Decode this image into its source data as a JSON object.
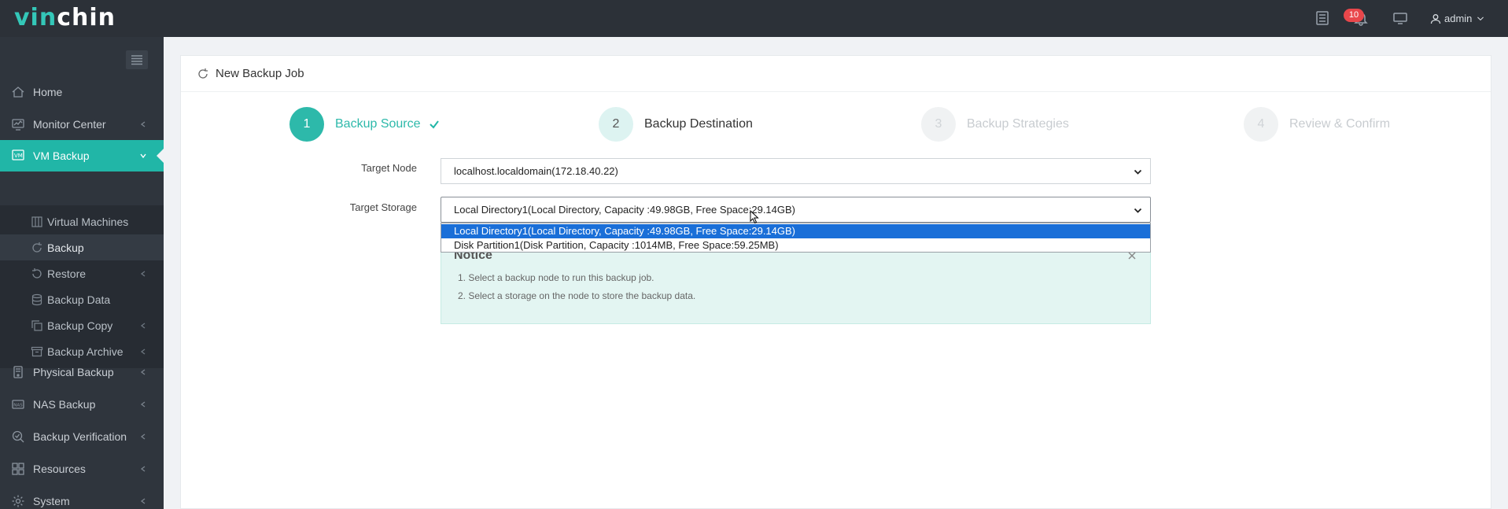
{
  "app": {
    "logo_a": "vin",
    "logo_b": "chin"
  },
  "topbar": {
    "notifications_count": "10",
    "user": "admin"
  },
  "sidebar": {
    "items": [
      {
        "label": "Home"
      },
      {
        "label": "Monitor Center"
      },
      {
        "label": "VM Backup"
      },
      {
        "label": "Physical Backup"
      },
      {
        "label": "NAS Backup"
      },
      {
        "label": "Backup Verification"
      },
      {
        "label": "Resources"
      },
      {
        "label": "System"
      }
    ],
    "vm_backup_sub": [
      {
        "label": "Virtual Machines"
      },
      {
        "label": "Backup"
      },
      {
        "label": "Restore"
      },
      {
        "label": "Backup Data"
      },
      {
        "label": "Backup Copy"
      },
      {
        "label": "Backup Archive"
      }
    ]
  },
  "page": {
    "title": "New Backup Job"
  },
  "wizard": {
    "steps": [
      {
        "number": "1",
        "label": "Backup Source"
      },
      {
        "number": "2",
        "label": "Backup Destination"
      },
      {
        "number": "3",
        "label": "Backup Strategies"
      },
      {
        "number": "4",
        "label": "Review & Confirm"
      }
    ],
    "current_step": 2
  },
  "form": {
    "target_node": {
      "label": "Target Node",
      "value": "localhost.localdomain(172.18.40.22)"
    },
    "target_storage": {
      "label": "Target Storage",
      "value": "Local Directory1(Local Directory, Capacity :49.98GB, Free Space:29.14GB)",
      "options": [
        "Local Directory1(Local Directory, Capacity :49.98GB, Free Space:29.14GB)",
        "Disk Partition1(Disk Partition, Capacity :1014MB, Free Space:59.25MB)"
      ],
      "selected_index": 0
    }
  },
  "notice": {
    "title": "Notice",
    "lines": [
      "1. Select a backup node to run this backup job.",
      "2. Select a storage on the node to store the backup data."
    ]
  },
  "colors": {
    "accent": "#21b6a7",
    "topbar": "#2c3138",
    "sidebar": "#2f353d",
    "badge": "#e9474b",
    "selection": "#1a6fd8"
  }
}
